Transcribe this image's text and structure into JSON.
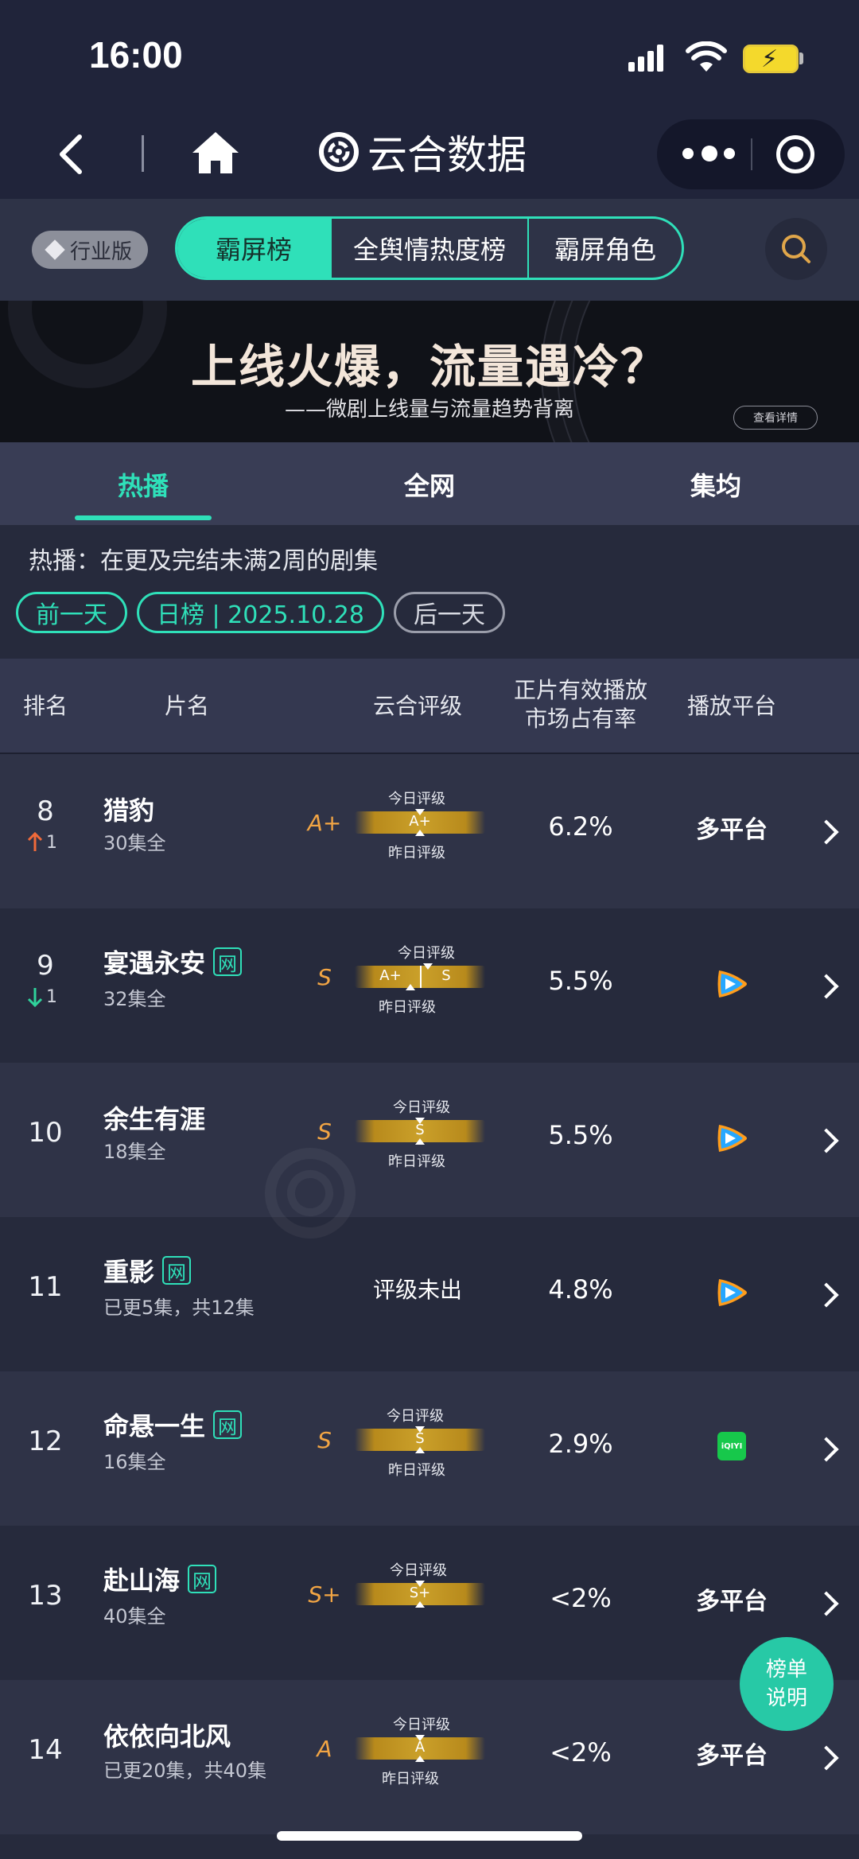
{
  "status": {
    "time": "16:00"
  },
  "nav": {
    "title": "云合数据"
  },
  "filter": {
    "edition": "行业版",
    "segments": [
      "霸屏榜",
      "全舆情热度榜",
      "霸屏角色"
    ]
  },
  "banner": {
    "title": "上线火爆，流量遇冷？",
    "subtitle": "——微剧上线量与流量趋势背离",
    "button": "查看详情"
  },
  "tabs": [
    "热播",
    "全网",
    "集均"
  ],
  "description": "热播：在更及完结未满2周的剧集",
  "date": {
    "prev": "前一天",
    "current": "日榜 | 2025.10.28",
    "next": "后一天"
  },
  "table": {
    "headers": {
      "rank": "排名",
      "name": "片名",
      "grade": "云合评级",
      "share_line1": "正片有效播放",
      "share_line2": "市场占有率",
      "platform": "播放平台"
    },
    "grade_today_label": "今日评级",
    "grade_yesterday_label": "昨日评级",
    "net_badge": "网",
    "rows": [
      {
        "rank": "8",
        "trend": "up",
        "trend_value": "1",
        "name": "猎豹",
        "net": false,
        "episodes": "30集全",
        "grade": "A+",
        "today": "A+",
        "yesterday": "",
        "share": "6.2%",
        "platform": "多平台",
        "platform_icon": ""
      },
      {
        "rank": "9",
        "trend": "down",
        "trend_value": "1",
        "name": "宴遇永安",
        "net": true,
        "episodes": "32集全",
        "grade": "S",
        "today": "S",
        "yesterday": "A+",
        "share": "5.5%",
        "platform": "",
        "platform_icon": "tencent-video-icon"
      },
      {
        "rank": "10",
        "trend": "",
        "trend_value": "",
        "name": "余生有涯",
        "net": false,
        "episodes": "18集全",
        "grade": "S",
        "today": "S",
        "yesterday": "",
        "share": "5.5%",
        "platform": "",
        "platform_icon": "tencent-video-icon"
      },
      {
        "rank": "11",
        "trend": "",
        "trend_value": "",
        "name": "重影",
        "net": true,
        "episodes": "已更5集，共12集",
        "grade": "",
        "today": "",
        "yesterday": "",
        "no_grade": "评级未出",
        "share": "4.8%",
        "platform": "",
        "platform_icon": "tencent-video-icon"
      },
      {
        "rank": "12",
        "trend": "",
        "trend_value": "",
        "name": "命悬一生",
        "net": true,
        "episodes": "16集全",
        "grade": "S",
        "today": "S",
        "yesterday": "",
        "share": "2.9%",
        "platform": "",
        "platform_icon": "iqiyi-icon",
        "platform_icon_text": "iQIYI"
      },
      {
        "rank": "13",
        "trend": "",
        "trend_value": "",
        "name": "赴山海",
        "net": true,
        "episodes": "40集全",
        "grade": "S+",
        "today": "S+",
        "yesterday": "",
        "share": "<2%",
        "platform": "多平台",
        "platform_icon": ""
      },
      {
        "rank": "14",
        "trend": "",
        "trend_value": "",
        "name": "依依向北风",
        "net": false,
        "episodes": "已更20集，共40集",
        "grade": "A",
        "today": "A",
        "yesterday": "",
        "share": "<2%",
        "platform": "多平台",
        "platform_icon": ""
      }
    ]
  },
  "float_button": {
    "line1": "榜单",
    "line2": "说明"
  },
  "colors": {
    "accent": "#2fe0b9",
    "grade": "#f2a544",
    "up": "#f06a3a",
    "down": "#2fd29b"
  }
}
